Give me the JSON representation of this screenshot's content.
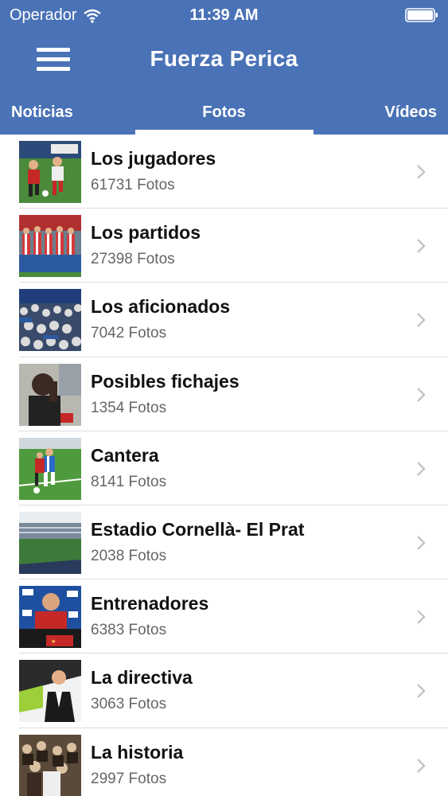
{
  "status_bar": {
    "carrier": "Operador",
    "time": "11:39 AM"
  },
  "navbar": {
    "title": "Fuerza Perica"
  },
  "tabs": [
    {
      "label": "Noticias",
      "selected": false
    },
    {
      "label": "Fotos",
      "selected": true
    },
    {
      "label": "Vídeos",
      "selected": false
    }
  ],
  "albums": [
    {
      "title": "Los jugadores",
      "count": "61731 Fotos",
      "thumb": "players-photo"
    },
    {
      "title": "Los partidos",
      "count": "27398 Fotos",
      "thumb": "matches-photo"
    },
    {
      "title": "Los aficionados",
      "count": "7042 Fotos",
      "thumb": "fans-photo"
    },
    {
      "title": "Posibles fichajes",
      "count": "1354 Fotos",
      "thumb": "signings-photo"
    },
    {
      "title": "Cantera",
      "count": "8141 Fotos",
      "thumb": "youth-photo"
    },
    {
      "title": "Estadio Cornellà- El Prat",
      "count": "2038 Fotos",
      "thumb": "stadium-photo"
    },
    {
      "title": "Entrenadores",
      "count": "6383 Fotos",
      "thumb": "coaches-photo"
    },
    {
      "title": "La directiva",
      "count": "3063 Fotos",
      "thumb": "board-photo"
    },
    {
      "title": "La historia",
      "count": "2997 Fotos",
      "thumb": "history-photo"
    }
  ],
  "colors": {
    "header": "#4a72b6",
    "indicator": "#ffffff",
    "divider": "#dcdcdc",
    "subtitle": "#666666"
  }
}
